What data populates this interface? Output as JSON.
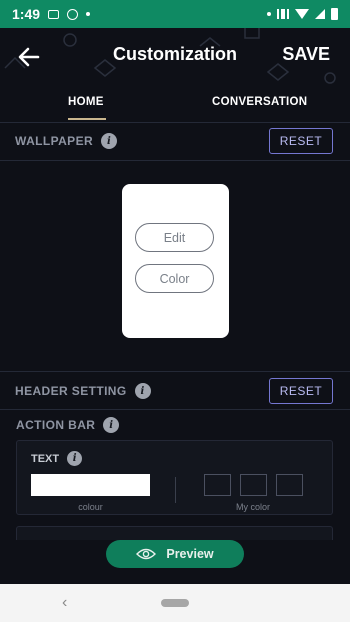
{
  "status_bar": {
    "time": "1:49"
  },
  "header": {
    "title": "Customization",
    "save_label": "SAVE",
    "back_icon": "arrow-left-icon"
  },
  "tabs": [
    {
      "label": "HOME",
      "active": true
    },
    {
      "label": "CONVERSATION",
      "active": false
    }
  ],
  "wallpaper": {
    "label": "WALLPAPER",
    "reset_label": "RESET",
    "edit_label": "Edit",
    "color_label": "Color"
  },
  "header_setting": {
    "label": "HEADER SETTING",
    "reset_label": "RESET"
  },
  "action_bar": {
    "label": "ACTION BAR",
    "text_label": "TEXT",
    "colour_caption": "colour",
    "my_color_caption": "My color",
    "selected_color": "#ffffff"
  },
  "preview": {
    "label": "Preview"
  },
  "colors": {
    "status_bar": "#0f8a63",
    "background": "#0e1017",
    "accent": "#7577d1",
    "preview_button": "#0f7e5b",
    "tab_indicator": "#c9b68e"
  }
}
